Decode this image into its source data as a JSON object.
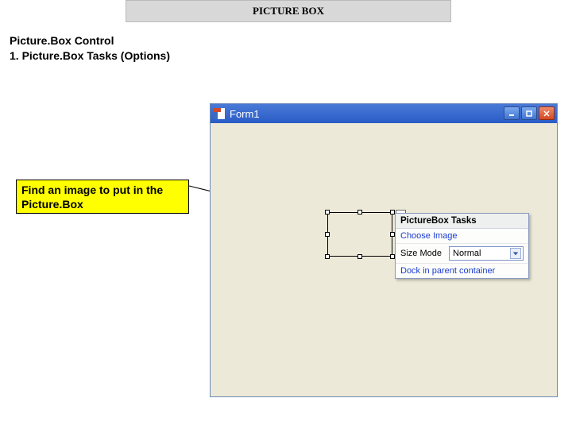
{
  "slide": {
    "title": "PICTURE BOX",
    "heading_line1": "Picture.Box Control",
    "heading_line2": "1.  Picture.Box Tasks (Options)",
    "callout": "Find an image to put in the Picture.Box"
  },
  "window": {
    "title": "Form1"
  },
  "tasks_popup": {
    "header": "PictureBox Tasks",
    "choose_image": "Choose Image",
    "size_mode_label": "Size Mode",
    "size_mode_value": "Normal",
    "dock_link": "Dock in parent container"
  }
}
